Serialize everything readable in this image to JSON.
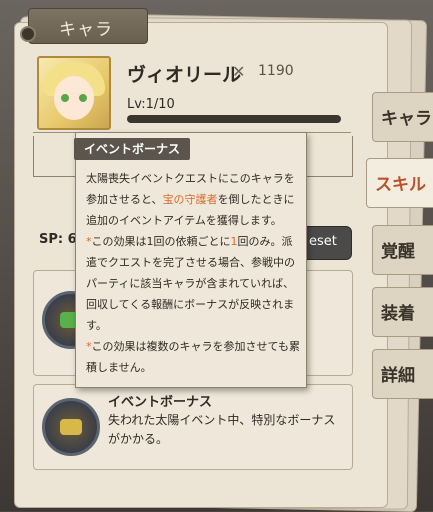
{
  "top_tab": {
    "label": "キャラ"
  },
  "character": {
    "name": "ヴィオリール",
    "power": "1190",
    "level": "Lv:1/10"
  },
  "side_tabs": [
    {
      "label": "キャラ"
    },
    {
      "label": "スキル"
    },
    {
      "label": "覚醒"
    },
    {
      "label": "装着"
    },
    {
      "label": "詳細"
    }
  ],
  "sp": {
    "label": "SP: 6"
  },
  "reset_button": {
    "label": "eset"
  },
  "skills": [
    {
      "title": "",
      "desc": ""
    },
    {
      "title": "イベントボーナス",
      "desc": "失われた太陽イベント中、特別なボーナスがかかる。"
    }
  ],
  "tooltip": {
    "header": "イベントボーナス",
    "p1_a": "太陽喪失イベントクエストにこのキャラを参加させると、",
    "p1_accent": "宝の守護者",
    "p1_b": "を倒したときに追加のイベントアイテムを獲得します。",
    "p2_star": "*",
    "p2_a": "この効果は1回の依頼ごとに",
    "p2_accent": "1",
    "p2_b": "回のみ。派遣でクエストを完了させる場合、参戦中のパーティに該当キャラが含まれていれば、回収してくる報酬にボーナスが反映されます。",
    "p3_star": "*",
    "p3_a": "この効果は複数のキャラを参加させても累積しません。"
  },
  "colors": {
    "accent": "#d86a2b",
    "active_tab": "#b7522c"
  }
}
